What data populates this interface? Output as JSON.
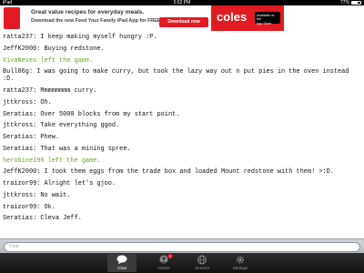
{
  "status_bar": {
    "carrier": "iPad",
    "time": "5:52 PM",
    "battery": "77%"
  },
  "ad": {
    "line1": "Great value recipes for everyday meals.",
    "line2": "Download the new Feed Your Family iPad App for FREE.",
    "download_label": "Download now",
    "brand": "coles",
    "appstore_line1": "Available on the",
    "appstore_line2": "App Store",
    "brand_color": "#e21b23"
  },
  "messages": [
    {
      "text": "ratta237: I keep making myself hungry :P.",
      "type": "chat"
    },
    {
      "text": "JeffK2000: Buying redstone.",
      "type": "chat"
    },
    {
      "text": "VivaNeves left the game.",
      "type": "system"
    },
    {
      "text": "Bull06g: I was going to make curry, but took the lazy way out n put pies in the oven instead :D.",
      "type": "chat"
    },
    {
      "text": "ratta237: Mmmmmmmm curry.",
      "type": "chat"
    },
    {
      "text": "jttkross: Oh.",
      "type": "chat"
    },
    {
      "text": "Seratias: Over 5000 blocks from my start point.",
      "type": "chat"
    },
    {
      "text": "jttkross: Take everything ggod.",
      "type": "chat"
    },
    {
      "text": "Seratias: Phew.",
      "type": "chat"
    },
    {
      "text": "Seratias: That was a mining spree.",
      "type": "chat"
    },
    {
      "text": "herobine196 left the game.",
      "type": "system"
    },
    {
      "text": "JeffK2000: I took them eggs from the trade box and loaded Mount redstone with them! >:D.",
      "type": "chat"
    },
    {
      "text": "traizor99: Alright let's gjoo.",
      "type": "chat"
    },
    {
      "text": "jttkross: No wait.",
      "type": "chat"
    },
    {
      "text": "traizor99: Ok.",
      "type": "chat"
    },
    {
      "text": "Seratias: Cleva Jeff.",
      "type": "chat"
    }
  ],
  "input": {
    "placeholder": "Chat"
  },
  "tabs": [
    {
      "label": "Chat",
      "icon": "chat-bubble-icon",
      "active": true
    },
    {
      "label": "Online",
      "icon": "online-users-icon",
      "badge": "2"
    },
    {
      "label": "Servers",
      "icon": "globe-icon"
    },
    {
      "label": "Settings",
      "icon": "gear-icon"
    }
  ],
  "colors": {
    "system_message": "#6aa51e",
    "text": "#111111"
  }
}
